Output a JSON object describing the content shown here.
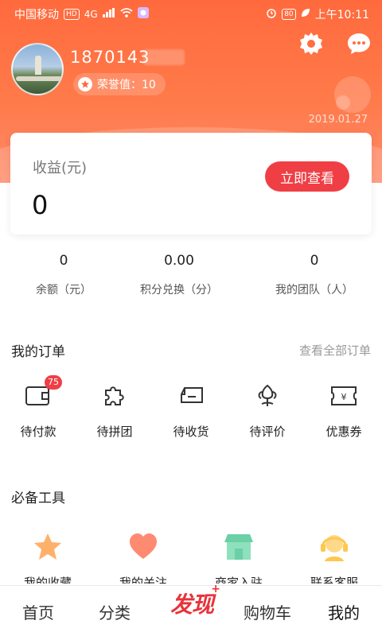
{
  "status_bar": {
    "carrier": "中国移动",
    "hd": "HD",
    "network": "4G",
    "battery": "80",
    "time": "上午10:11"
  },
  "profile": {
    "phone": "1870143",
    "honor_label": "荣誉值：10",
    "date": "2019.01.27"
  },
  "earnings": {
    "label": "收益(元)",
    "amount": "0",
    "button": "立即查看"
  },
  "stats": [
    {
      "value": "0",
      "label": "余额（元）"
    },
    {
      "value": "0.00",
      "label": "积分兑换（分）"
    },
    {
      "value": "0",
      "label": "我的团队（人）"
    }
  ],
  "orders": {
    "title": "我的订单",
    "view_all": "查看全部订单",
    "items": [
      {
        "label": "待付款",
        "badge": "75",
        "icon": "wallet-icon"
      },
      {
        "label": "待拼团",
        "icon": "puzzle-icon"
      },
      {
        "label": "待收货",
        "icon": "truck-icon"
      },
      {
        "label": "待评价",
        "icon": "flower-icon"
      },
      {
        "label": "优惠券",
        "icon": "coupon-icon"
      }
    ]
  },
  "tools": {
    "title": "必备工具",
    "items": [
      {
        "label": "我的收藏",
        "icon": "star-icon",
        "color": "#ffb06a"
      },
      {
        "label": "我的关注",
        "icon": "heart-icon",
        "color": "#ff8a72"
      },
      {
        "label": "商家入驻",
        "icon": "shop-icon",
        "color": "#6ad0a6"
      },
      {
        "label": "联系客服",
        "icon": "headset-icon",
        "color": "#ffc74d"
      }
    ]
  },
  "nav": {
    "home": "首页",
    "category": "分类",
    "center": "发现",
    "cart": "购物车",
    "mine": "我的"
  },
  "colors": {
    "accent": "#ef3f45",
    "header_gradient_top": "#ff6a3d",
    "header_gradient_bottom": "#ff8a6a"
  }
}
